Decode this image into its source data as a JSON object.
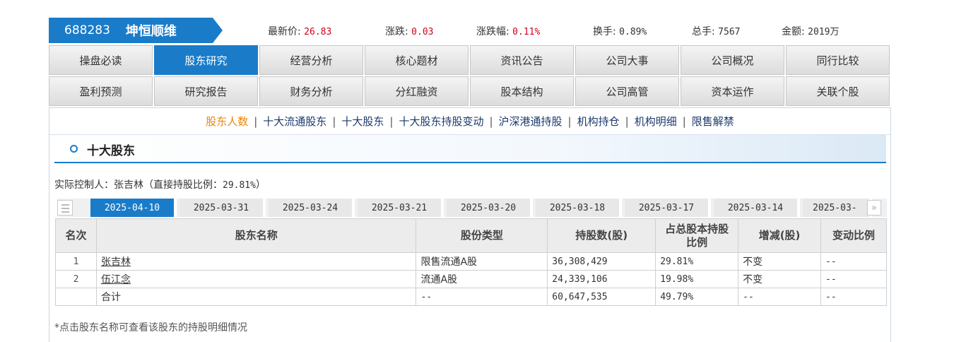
{
  "stock": {
    "code": "688283",
    "name": "坤恒顺维"
  },
  "quotes": [
    {
      "label": "最新价:",
      "value": "26.83",
      "red": true
    },
    {
      "label": "涨跌:",
      "value": "0.03",
      "red": true
    },
    {
      "label": "涨跌幅:",
      "value": "0.11%",
      "red": true
    },
    {
      "label": "换手:",
      "value": "0.89%",
      "red": false
    },
    {
      "label": "总手:",
      "value": "7567",
      "red": false
    },
    {
      "label": "金额:",
      "value": "2019万",
      "red": false
    }
  ],
  "nav": {
    "row1": [
      "操盘必读",
      "股东研究",
      "经营分析",
      "核心题材",
      "资讯公告",
      "公司大事",
      "公司概况",
      "同行比较"
    ],
    "row2": [
      "盈利预测",
      "研究报告",
      "财务分析",
      "分红融资",
      "股本结构",
      "公司高管",
      "资本运作",
      "关联个股"
    ],
    "active": "股东研究"
  },
  "sublinks": {
    "items": [
      "股东人数",
      "十大流通股东",
      "十大股东",
      "十大股东持股变动",
      "沪深港通持股",
      "机构持仓",
      "机构明细",
      "限售解禁"
    ],
    "active": "股东人数",
    "separator": "|"
  },
  "section": {
    "title": "十大股东"
  },
  "controller": {
    "label": "实际控制人：张吉林（直接持股比例：",
    "value": "29.81%",
    "close": "）"
  },
  "date_tabs": {
    "items": [
      "2025-04-10",
      "2025-03-31",
      "2025-03-24",
      "2025-03-21",
      "2025-03-20",
      "2025-03-18",
      "2025-03-17",
      "2025-03-14",
      "2025-03-"
    ],
    "active": "2025-04-10",
    "next_glyph": "»"
  },
  "table": {
    "headers": [
      "名次",
      "股东名称",
      "股份类型",
      "持股数(股)",
      "占总股本持股比例",
      "增减(股)",
      "变动比例"
    ],
    "rows": [
      {
        "rank": "1",
        "name": "张吉林",
        "type": "限售流通A股",
        "shares": "36,308,429",
        "ratio": "29.81%",
        "change": "不变",
        "change_ratio": "--"
      },
      {
        "rank": "2",
        "name": "伍江念",
        "type": "流通A股",
        "shares": "24,339,106",
        "ratio": "19.98%",
        "change": "不变",
        "change_ratio": "--"
      }
    ],
    "total": {
      "label": "合计",
      "type": "--",
      "shares": "60,647,535",
      "ratio": "49.79%",
      "change": "--",
      "change_ratio": "--"
    }
  },
  "note": "*点击股东名称可查看该股东的持股明细情况",
  "colors": {
    "accent": "#1a7cc9",
    "price_red": "#d0021b",
    "sublink_active": "#e8860c",
    "sublink": "#1b3a6b"
  }
}
